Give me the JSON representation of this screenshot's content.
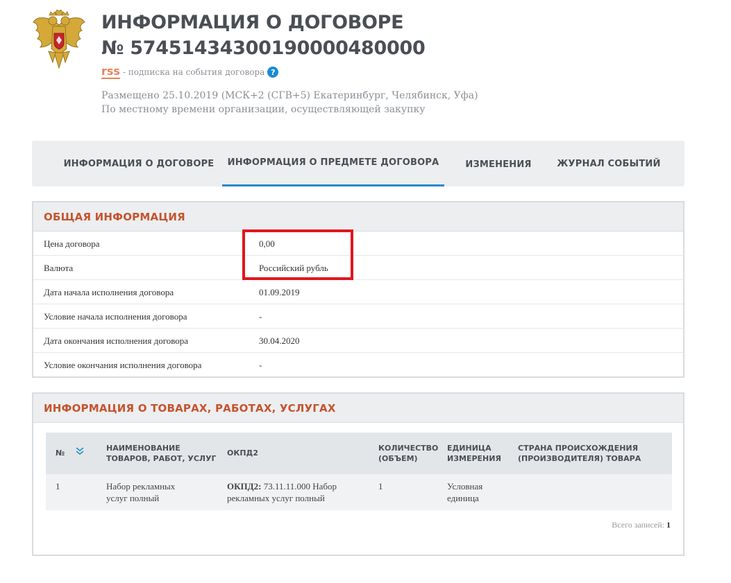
{
  "header": {
    "emblem_icon": "russian-coat-of-arms-icon",
    "title_line1": "ИНФОРМАЦИЯ О ДОГОВОРЕ",
    "title_line2": "№ 57451434300190000480000",
    "rss_label": "rss",
    "rss_suffix": "- подписка на события договора",
    "help_icon": "question-circle-icon",
    "help_glyph": "?",
    "placed_line1": "Размещено 25.10.2019 (МСК+2 (СГВ+5) Екатеринбург, Челябинск, Уфа)",
    "placed_line2": "По местному времени организации, осуществляющей закупку"
  },
  "tabs": [
    {
      "label": "ИНФОРМАЦИЯ О ДОГОВОРЕ",
      "active": false
    },
    {
      "label": "ИНФОРМАЦИЯ О ПРЕДМЕТЕ ДОГОВОРА",
      "active": true
    },
    {
      "label": "ИЗМЕНЕНИЯ",
      "active": false
    },
    {
      "label": "ЖУРНАЛ СОБЫТИЙ",
      "active": false
    }
  ],
  "general": {
    "heading": "ОБЩАЯ ИНФОРМАЦИЯ",
    "rows": [
      {
        "label": "Цена договора",
        "value": "0,00"
      },
      {
        "label": "Валюта",
        "value": "Российский рубль"
      },
      {
        "label": "Дата начала исполнения договора",
        "value": "01.09.2019"
      },
      {
        "label": "Условие начала исполнения договора",
        "value": "-"
      },
      {
        "label": "Дата окончания исполнения договора",
        "value": "30.04.2020"
      },
      {
        "label": "Условие окончания исполнения договора",
        "value": "-"
      }
    ]
  },
  "goods": {
    "heading": "ИНФОРМАЦИЯ О ТОВАРАХ, РАБОТАХ, УСЛУГАХ",
    "columns": {
      "num": "№",
      "name_1": "НАИМЕНОВАНИЕ",
      "name_2": "ТОВАРОВ, РАБОТ, УСЛУГ",
      "okpd": "ОКПД2",
      "qty_1": "КОЛИЧЕСТВО",
      "qty_2": "(ОБЪЕМ)",
      "unit_1": "ЕДИНИЦА",
      "unit_2": "ИЗМЕРЕНИЯ",
      "country_1": "СТРАНА ПРОИСХОЖДЕНИЯ",
      "country_2": "(ПРОИЗВОДИТЕЛЯ) ТОВАРА"
    },
    "sort_icon": "double-chevron-down-icon",
    "rows": [
      {
        "num": "1",
        "name_1": "Набор рекламных",
        "name_2": "услуг полный",
        "okpd_prefix": "ОКПД2:",
        "okpd_1": "73.11.11.000 Набор",
        "okpd_2": "рекламных услуг полный",
        "qty": "1",
        "unit_1": "Условная",
        "unit_2": "единица",
        "country": ""
      }
    ],
    "total_label": "Всего записей:",
    "total_count": "1"
  },
  "colors": {
    "accent_blue": "#1f8ac8",
    "heading_orange": "#c6532e",
    "highlight_red": "#e0161d",
    "rss_orange": "#e8825a"
  }
}
